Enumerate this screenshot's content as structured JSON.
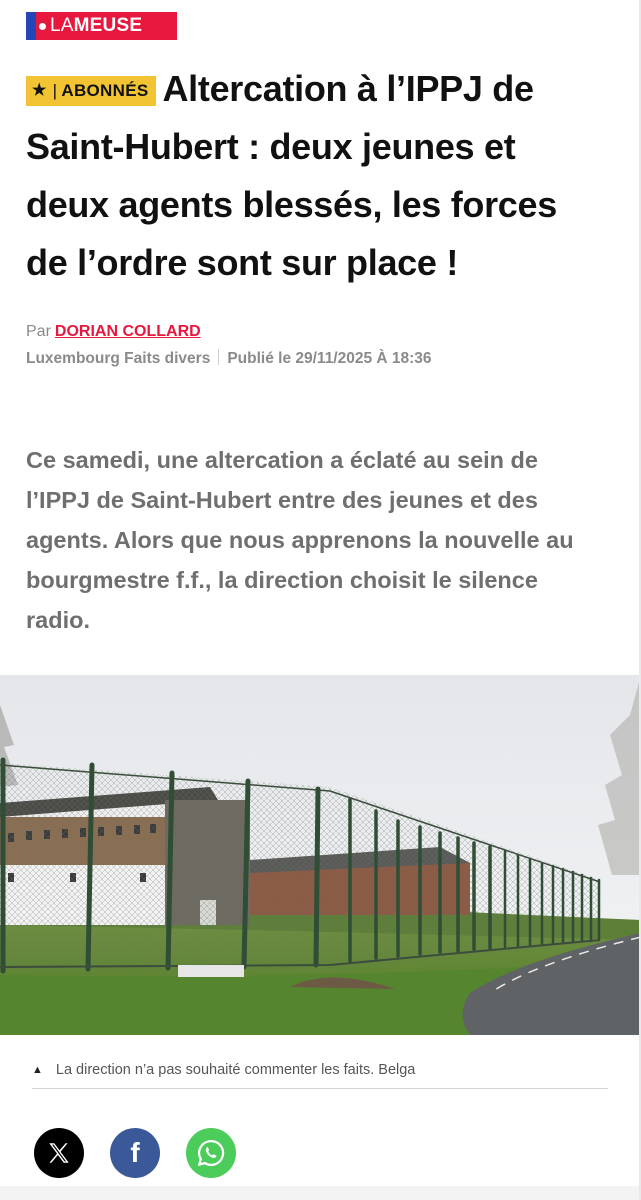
{
  "brand": {
    "name_light": "LA",
    "name_bold": "MEUSE",
    "color": "#e8173d",
    "flag_color": "#2446b9"
  },
  "article": {
    "badge": {
      "star": "★",
      "label": "ABONNÉS",
      "color": "#f2c434"
    },
    "headline": "Altercation à l’IPPJ de Saint-Hubert : deux jeunes et deux agents blessés, les forces de l’ordre sont sur place !",
    "byline_prefix": "Par",
    "author": "DORIAN COLLARD",
    "section": "Luxembourg Faits divers",
    "published": "Publié le 29/11/2025 À 18:36",
    "lead": "Ce samedi, une altercation a éclaté au sein de l’IPPJ de Saint-Hubert entre des jeunes et des agents. Alors que nous apprenons la nouvelle au bourgmestre f.f., la direction choisit le silence radio.",
    "image": {
      "subject": "building-behind-fence"
    },
    "caption": "La direction n’a pas souhaité commenter les faits. Belga",
    "caption_icon": "▲"
  },
  "share": [
    {
      "network": "X",
      "icon": "x-icon",
      "color": "#000000"
    },
    {
      "network": "Facebook",
      "icon": "facebook-icon",
      "glyph": "f",
      "color": "#3b5998"
    },
    {
      "network": "WhatsApp",
      "icon": "whatsapp-icon",
      "color": "#4ccc5a"
    }
  ]
}
